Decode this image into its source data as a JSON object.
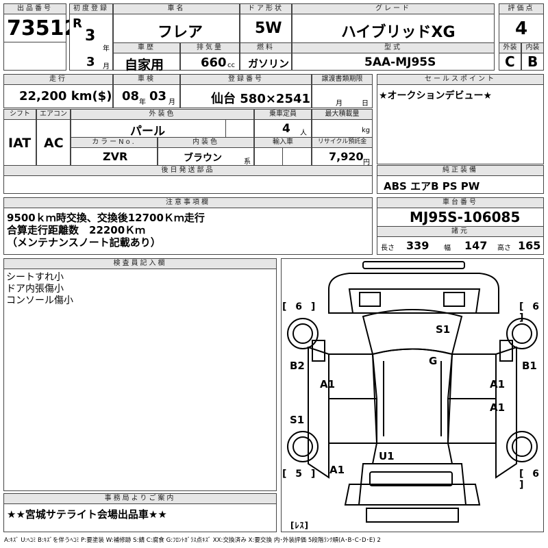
{
  "labels": {
    "lot_no": "出品番号",
    "first_reg": "初度登録",
    "car_name": "車名",
    "door": "ドア形状",
    "grade": "グレード",
    "score": "評価点",
    "history": "車歴",
    "displacement": "排気量",
    "fuel": "燃料",
    "model": "型式",
    "exterior": "外装",
    "interior": "内装",
    "mileage": "走行",
    "inspection": "車検",
    "reg_no": "登録番号",
    "transfer_deadline": "譲渡書類期限",
    "sales_point": "セールスポイント",
    "shift": "シフト",
    "aircon": "エアコン",
    "ext_color": "外装色",
    "capacity": "乗車定員",
    "max_load": "最大積載量",
    "color_no": "カラーNo.",
    "int_color": "内装色",
    "import": "輸入車",
    "recycle": "リサイクル預託金",
    "later_parts": "後日発送部品",
    "genuine_equip": "純正装備",
    "notes": "注意事項欄",
    "chassis": "車台番号",
    "dims": "諸元",
    "inspector": "検査員記入欄",
    "office": "事務局よりご案内"
  },
  "lot": "73512",
  "first_reg": {
    "era": "R",
    "year": "3",
    "year_unit": "年",
    "month": "3",
    "month_unit": "月"
  },
  "car_name": "フレア",
  "door": "5W",
  "grade": "ハイブリッドXG",
  "score": "4",
  "history": "自家用",
  "displacement": "660",
  "displacement_unit": "cc",
  "fuel": "ガソリン",
  "model": "5AA-MJ95S",
  "exterior_grade": "C",
  "interior_grade": "B",
  "mileage": "22,200 km($)",
  "inspection": {
    "year": "08",
    "year_unit": "年",
    "month": "03",
    "month_unit": "月"
  },
  "reg_no": "仙台 580×2541",
  "transfer": {
    "month_unit": "月",
    "day_unit": "日"
  },
  "sales_point": "★オークションデビュー★",
  "shift": "IAT",
  "aircon": "AC",
  "ext_color": "パール",
  "capacity": "4",
  "capacity_unit": "人",
  "max_load_unit": "kg",
  "color_no": "ZVR",
  "int_color": "ブラウン",
  "int_color_unit": "系",
  "recycle": "7,920",
  "recycle_unit": "円",
  "genuine_equip": "ABS エアB PS PW",
  "notes": [
    "9500ｋｍ時交換、交換後12700Ｋｍ走行",
    "合算走行距離数　22200Ｋｍ",
    "（メンテナンスノート記載あり）"
  ],
  "chassis": "MJ95S-106085",
  "dims": {
    "length_label": "長さ",
    "length": "339",
    "width_label": "幅",
    "width": "147",
    "height_label": "高さ",
    "height": "165"
  },
  "inspector_notes": [
    "シートすれ小",
    "ドア内張傷小",
    "コンソール傷小"
  ],
  "office": "★★宮城サテライト会場出品車★★",
  "diagram": {
    "tires": {
      "fl": "[ 6 ]",
      "fr": "[ 6 ]",
      "rl": "[ 5 ]",
      "rr": "[ 6 ]",
      "spare": "[ﾚｽ]"
    },
    "marks": {
      "roof": "S1",
      "windshield": "G",
      "left_front_door": "B2",
      "right_front_door": "B1",
      "left_rear": "S1",
      "lf_seat": "A1",
      "rf_seat": "A1",
      "rr_seat": "A1",
      "rear_glass": "U1",
      "rear_left": "A1"
    }
  },
  "legend": "A:ｷｽﾞ U:ﾍｺﾐ B:ｷｽﾞを伴うﾍｺﾐ P:要塗装 W:補修跡 S:錆 C:腐食 G:ﾌﾛﾝﾄｶﾞﾗｽ点ｷｽﾞ XX:交換済み X:要交換 内･外装評価 5段階ﾗﾝｸ順(A･B･C･D･E) 2"
}
